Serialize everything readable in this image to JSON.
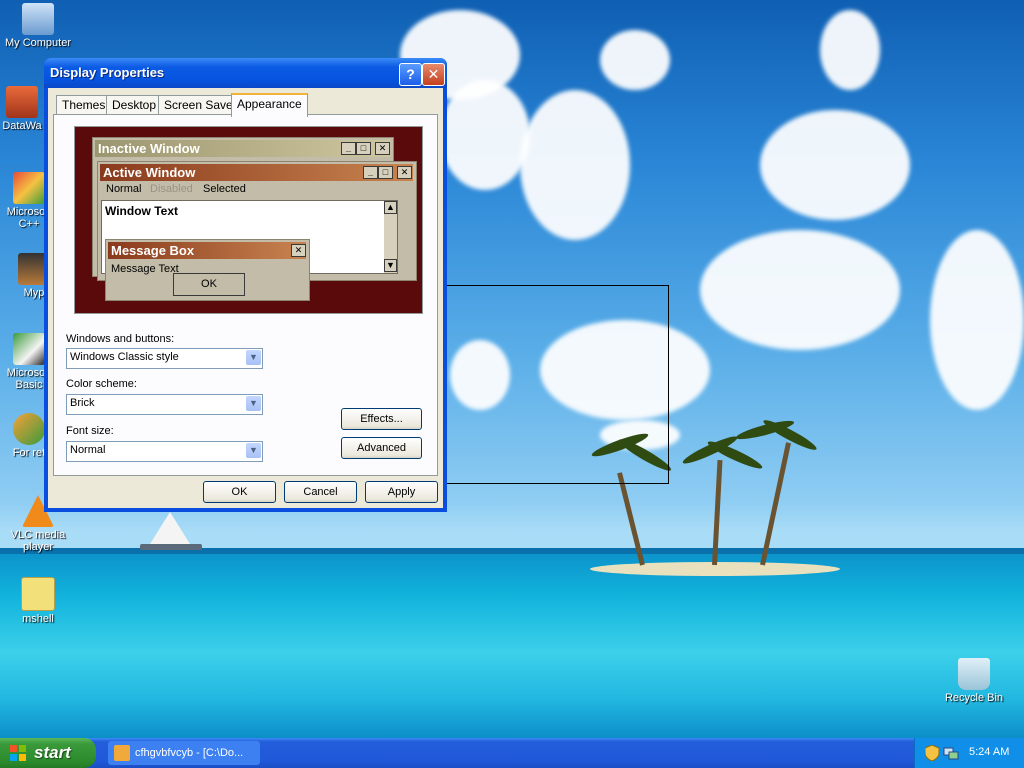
{
  "desktop": {
    "icons": [
      {
        "label": "My Computer",
        "icon": "computer-icon"
      },
      {
        "label": "DataWa",
        "icon": "app-icon"
      },
      {
        "label": "Microsoft C++",
        "icon": "visual-cpp-icon"
      },
      {
        "label": "Myp",
        "icon": "app-icon"
      },
      {
        "label": "Microsoft Basic",
        "icon": "visual-basic-icon"
      },
      {
        "label": "For ret",
        "icon": "app-icon"
      },
      {
        "label": "VLC media player",
        "icon": "vlc-icon"
      },
      {
        "label": "mshell",
        "icon": "folder-zip-icon"
      },
      {
        "label": "Recycle Bin",
        "icon": "recycle-bin-icon"
      }
    ]
  },
  "window": {
    "title": "Display Properties",
    "help_btn": "?",
    "close_btn": "✕",
    "tabs": [
      "Themes",
      "Desktop",
      "Screen Saver",
      "Appearance"
    ],
    "active_tab": "Appearance",
    "preview": {
      "inactive_title": "Inactive Window",
      "active_title": "Active Window",
      "menu": {
        "normal": "Normal",
        "disabled": "Disabled",
        "selected": "Selected"
      },
      "window_text": "Window Text",
      "msgbox_title": "Message Box",
      "msgbox_text": "Message Text",
      "ok": "OK"
    },
    "form": {
      "windows_buttons_label": "Windows and buttons:",
      "windows_buttons_value": "Windows Classic style",
      "color_scheme_label": "Color scheme:",
      "color_scheme_value": "Brick",
      "font_size_label": "Font size:",
      "font_size_value": "Normal",
      "effects_btn": "Effects...",
      "advanced_btn": "Advanced"
    },
    "buttons": {
      "ok": "OK",
      "cancel": "Cancel",
      "apply": "Apply"
    }
  },
  "taskbar": {
    "start": "start",
    "task_title": "cfhgvbfvcyb - [C:\\Do...",
    "clock": "5:24 AM"
  },
  "colors": {
    "xp_blue": "#0654e0",
    "brick_active": "#8a3a1c",
    "brick_inactive": "#b7ac84",
    "start_green": "#3a9a3a"
  }
}
